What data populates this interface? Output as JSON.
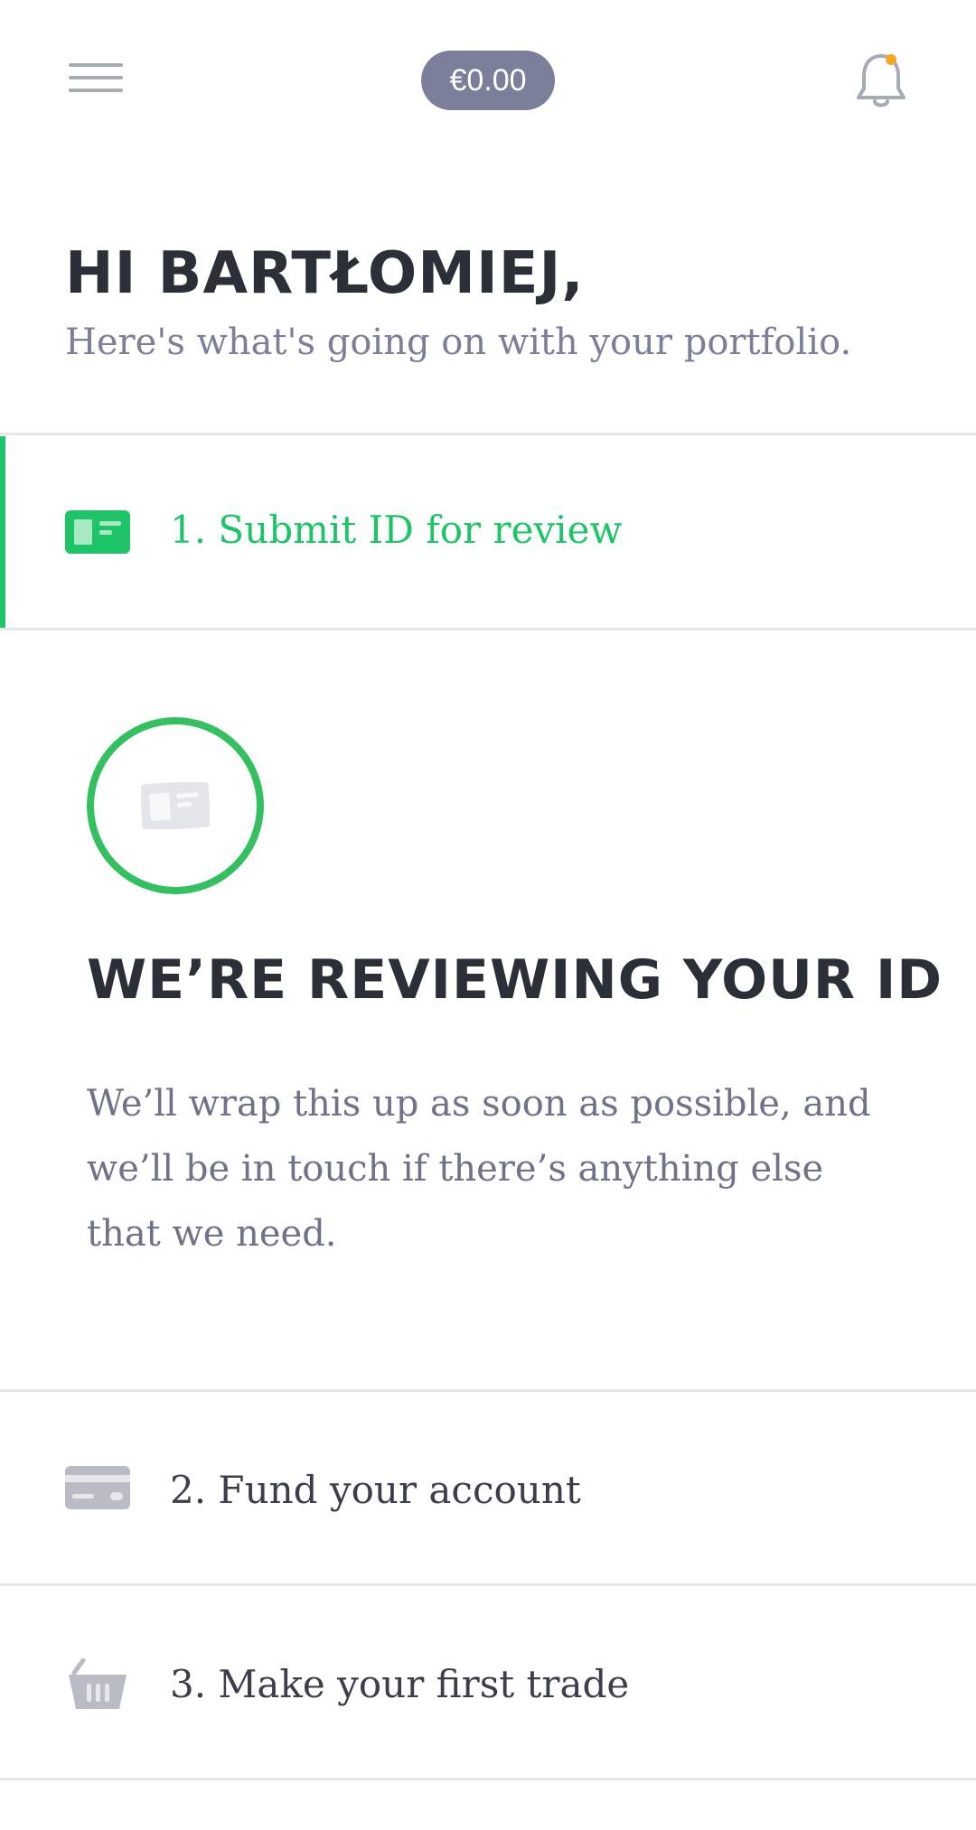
{
  "header": {
    "menu_icon": "hamburger-menu-icon",
    "balance": "€0.00",
    "notifications_icon": "bell-icon",
    "notification_dot_color": "#f5a623"
  },
  "greeting": {
    "name": "HI BARTŁOMIEJ",
    "subtitle": "Here's what's going on with your portfolio."
  },
  "steps": [
    {
      "label": "1. Submit ID for review",
      "icon": "id-card-icon",
      "active": true,
      "color": "#1fc468"
    },
    {
      "label": "2. Fund your account",
      "icon": "credit-card-icon",
      "active": false,
      "color": "#3a3f4b"
    },
    {
      "label": "3. Make your first trade",
      "icon": "basket-icon",
      "active": false,
      "color": "#3a3f4b"
    }
  ],
  "review": {
    "icon": "id-card-icon",
    "ring_color": "#34c060",
    "title": "WE’RE REVIEWING YOUR ID",
    "body": "We’ll wrap this up as soon as possible, and we’ll be in touch if there’s anything else that we need."
  }
}
